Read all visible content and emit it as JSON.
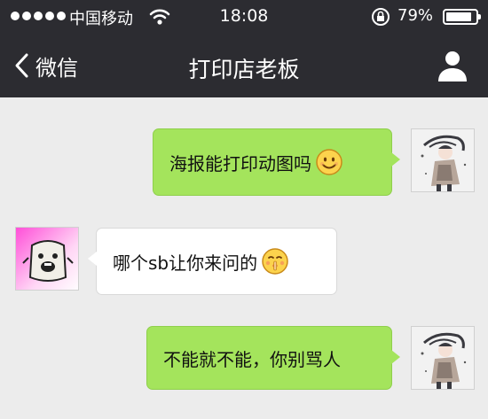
{
  "status_bar": {
    "carrier": "中国移动",
    "time": "18:08",
    "battery_percent": "79%",
    "battery_level": 0.79,
    "icons": [
      "signal-dots-icon",
      "wifi-icon",
      "rotation-lock-icon",
      "battery-icon"
    ]
  },
  "nav": {
    "back_label": "微信",
    "title": "打印店老板",
    "back_icon": "chevron-left-icon",
    "profile_icon": "person-icon"
  },
  "messages": [
    {
      "sender": "me",
      "text": "海报能打印动图吗",
      "emoji": "smiling-face-icon"
    },
    {
      "sender": "other",
      "text": "哪个sb让你来问的",
      "emoji": "hush-face-icon"
    },
    {
      "sender": "me",
      "text": "不能就不能，你别骂人"
    }
  ],
  "colors": {
    "bar_background": "#2c2c31",
    "chat_background": "#ececec",
    "my_bubble": "#a4e45c",
    "their_bubble": "#ffffff"
  }
}
